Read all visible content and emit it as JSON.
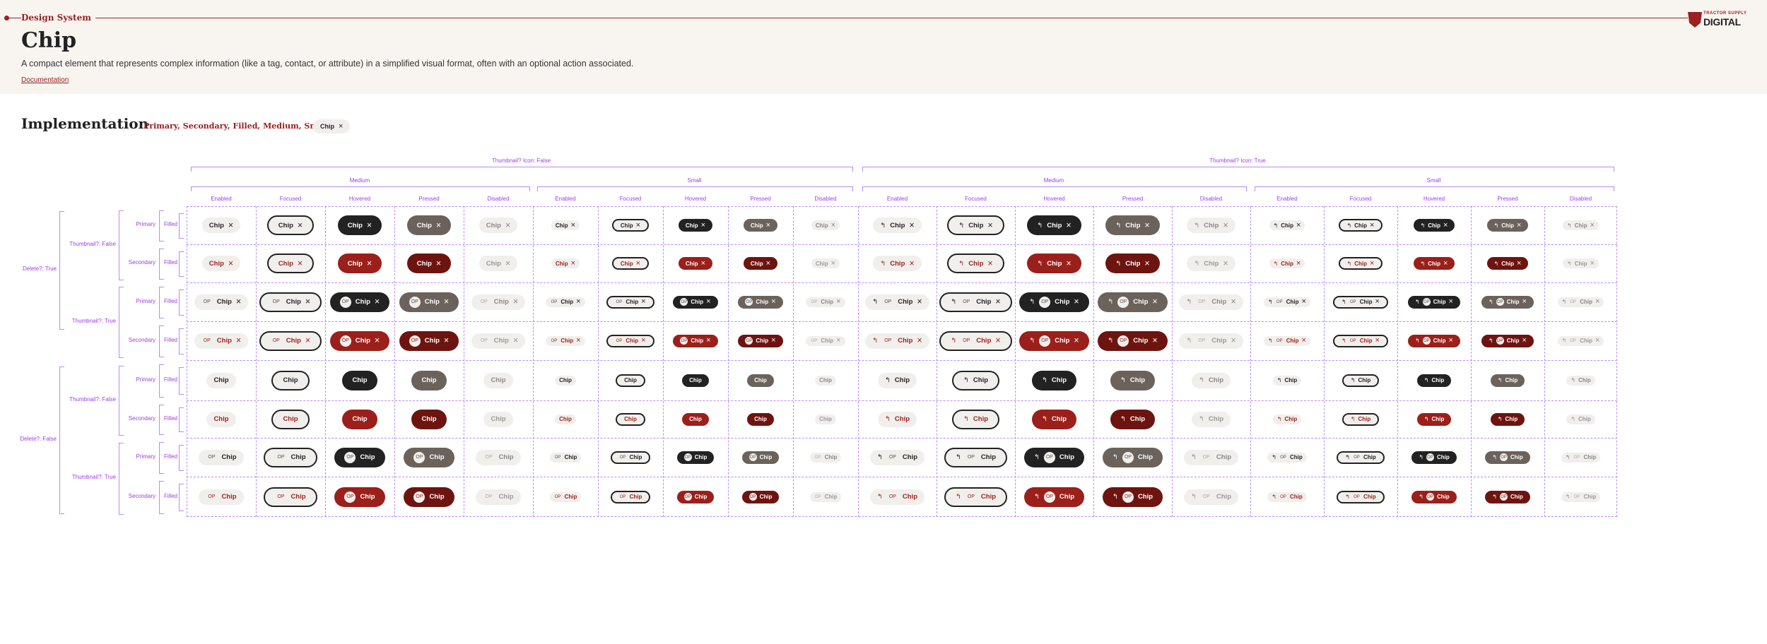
{
  "header": {
    "section": "Design System",
    "title": "Chip",
    "description": "A compact element that represents complex information (like a tag, contact, or attribute) in a simplified visual format, often with an optional action associated.",
    "doc_link": "Documentation",
    "logo_small": "TRACTOR SUPPLY",
    "logo_big": "DIGITAL"
  },
  "implementation": {
    "title": "Implementation",
    "props": "Primary, Secondary, Filled, Medium, Small",
    "sample_label": "Chip",
    "sample_close": "×"
  },
  "matrix": {
    "thumb_groups": [
      "Thumbnail? Icon: False",
      "Thumbnail? Icon: True"
    ],
    "sizes": [
      "Medium",
      "Small"
    ],
    "states": [
      "Enabled",
      "Focused",
      "Hovered",
      "Pressed",
      "Disabled"
    ],
    "delete_groups": [
      "Delete?: True",
      "Delete?: False"
    ],
    "thumbnail_groups": [
      "Thumbnail?: False",
      "Thumbnail?: True"
    ],
    "variants": [
      "Primary",
      "Secondary"
    ],
    "style": "Filled",
    "chip_label": "Chip",
    "thumb_text": "OP",
    "close_glyph": "×",
    "icon_glyph": "↰"
  },
  "colors": {
    "brand_red": "#9b2020",
    "primary_hover": "#222222",
    "primary_pressed": "#6b625c",
    "secondary_hover": "#9b1f1a",
    "secondary_pressed": "#6e1410",
    "chip_bg": "#f1efec",
    "annotation": "#9b3ee8"
  }
}
